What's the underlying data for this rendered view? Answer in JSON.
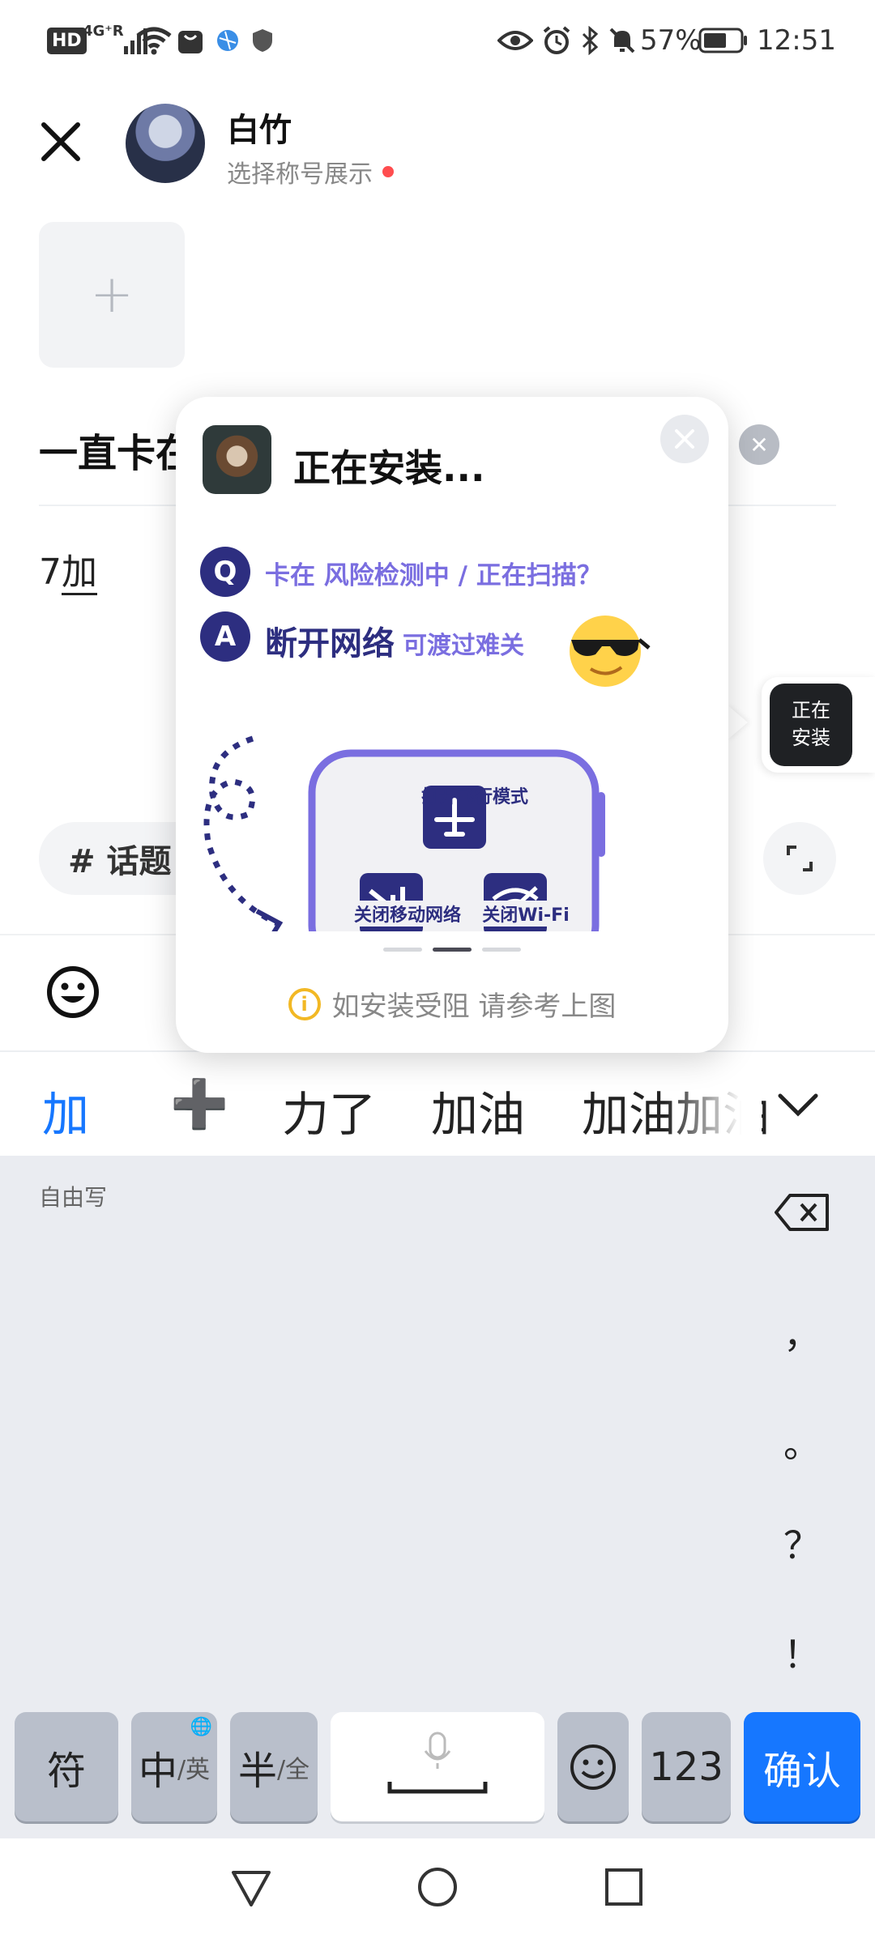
{
  "status_bar": {
    "hd": "HD",
    "network": "4G⁺R",
    "battery": "57%",
    "time": "12:51"
  },
  "header": {
    "username": "白竹",
    "subtitle": "选择称号展示"
  },
  "post": {
    "add_symbol": "+",
    "title_text": "一直卡在",
    "body_prefix": "7",
    "body_composing": "加"
  },
  "topic": {
    "label": "# 话题"
  },
  "candidates": [
    "加",
    "➕",
    "力了",
    "加油",
    "加油加油"
  ],
  "keyboard": {
    "mode_label": "自由写",
    "punctuation": [
      "，",
      "。",
      "？",
      "！"
    ],
    "keys": {
      "symbols": "符",
      "lang_main": "中",
      "lang_alt": "/英",
      "width_main": "半",
      "width_alt": "/全",
      "numbers": "123",
      "confirm": "确认"
    }
  },
  "popup": {
    "title": "正在安装...",
    "q_badge": "Q",
    "a_badge": "A",
    "question": "卡在 风险检测中 / 正在扫描？",
    "answer_main": "断开网络",
    "answer_sub": "可渡过难关",
    "step_airplane": "打开飞行模式",
    "step_mobile": "关闭移动网络",
    "step_wifi": "关闭Wi-Fi",
    "hint": "如安装受阻 请参考上图",
    "pager": {
      "count": 3,
      "active": 2
    }
  },
  "side_tab": {
    "line1": "正在",
    "line2": "安装"
  },
  "colors": {
    "accent": "#1677ff",
    "popup_navy": "#2d2e80",
    "popup_purple": "#7a6ee0",
    "red_dot": "#ff4d4f"
  }
}
